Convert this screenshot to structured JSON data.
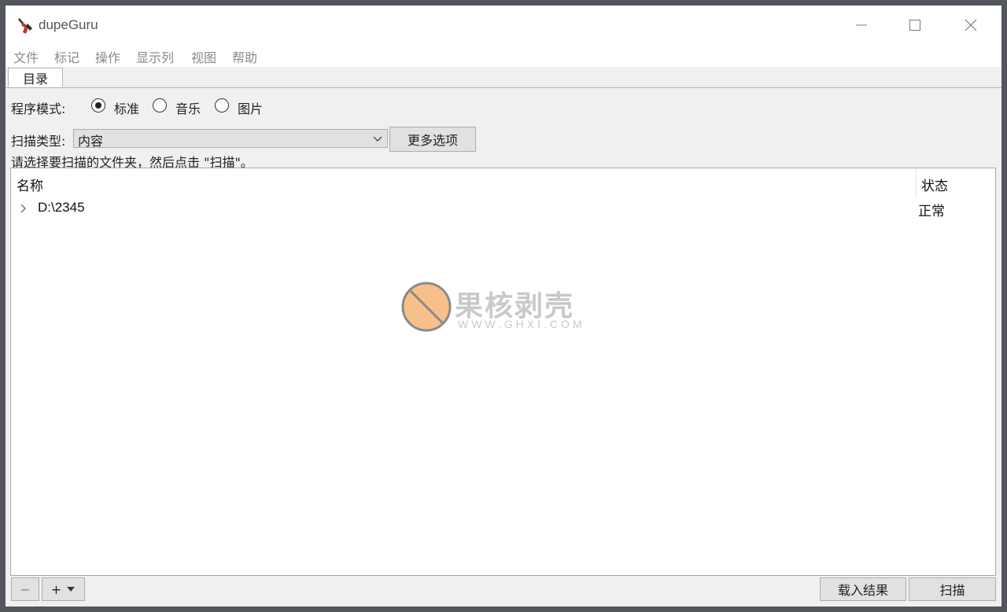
{
  "window": {
    "title": "dupeGuru",
    "controls": [
      "minimize-icon",
      "maximize-icon",
      "close-icon"
    ]
  },
  "menu": {
    "items": [
      "文件",
      "标记",
      "操作",
      "显示列",
      "视图",
      "帮助"
    ]
  },
  "tabs": [
    {
      "label": "目录",
      "active": true
    }
  ],
  "mode": {
    "label": "程序模式:",
    "options": [
      {
        "label": "标准",
        "selected": true
      },
      {
        "label": "音乐",
        "selected": false
      },
      {
        "label": "图片",
        "selected": false
      }
    ]
  },
  "scan_type": {
    "label": "扫描类型:",
    "value": "内容",
    "more_options_label": "更多选项"
  },
  "hint": "请选择要扫描的文件夹，然后点击 \"扫描\"。",
  "table": {
    "columns": [
      "名称",
      "状态"
    ],
    "rows": [
      {
        "name": "D:\\2345",
        "state": "正常"
      }
    ]
  },
  "watermark": {
    "text": "果核剥壳",
    "url": "WWW.GHXI.COM"
  },
  "bottom": {
    "remove_label": "−",
    "add_label": "+",
    "load_results_label": "载入结果",
    "scan_label": "扫描"
  },
  "colors": {
    "window_bg": "#f0f0f0",
    "desktop_bg": "#53565a",
    "watermark_orange": "#f7c08a"
  }
}
